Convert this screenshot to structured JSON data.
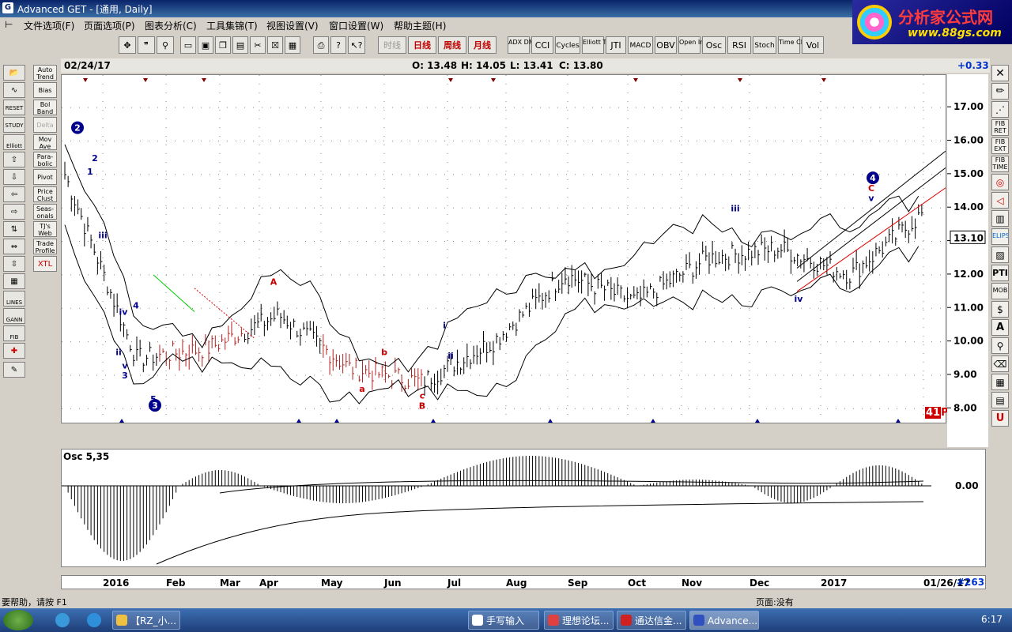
{
  "window": {
    "title": "Advanced GET - [通用, Daily]"
  },
  "logo": {
    "text1": "分析家公式网",
    "text2": "www.88gs.com"
  },
  "menu": [
    "文件选项(F)",
    "页面选项(P)",
    "图表分析(C)",
    "工具集锦(T)",
    "视图设置(V)",
    "窗口设置(W)",
    "帮助主题(H)"
  ],
  "toolbar": {
    "period_buttons": [
      "时线",
      "日线",
      "周线",
      "月线"
    ],
    "study_buttons": [
      "ADX DMI",
      "CCI",
      "Cycles",
      "Elliott Trig",
      "JTI",
      "MACD",
      "OBV",
      "Open Int",
      "Osc",
      "RSI",
      "Stoch",
      "Time Clust",
      "Vol"
    ]
  },
  "left_tools": [
    "RESET",
    "STUDY",
    "Elliott",
    "LINES",
    "GANN",
    "FIB"
  ],
  "study_panel": [
    "Auto Trend",
    "Bias",
    "Bol Band",
    "Delta",
    "Mov Ave",
    "Para-bolic",
    "Pivot",
    "Price Clust",
    "Seas-onals",
    "TJ's Web",
    "Trade Profile",
    "XTL"
  ],
  "right_tools": [
    "FIB RET",
    "FIB EXT",
    "FIB TIME",
    "ELIPS",
    "PTI",
    "MOB"
  ],
  "info": {
    "date": "02/24/17",
    "open": "O: 13.48",
    "high": "H: 14.05",
    "low": "L: 13.41",
    "close": "C: 13.80",
    "change": "+0.33"
  },
  "price_axis": {
    "labels": [
      "17.00",
      "16.00",
      "15.00",
      "14.00",
      "13.00",
      "12.00",
      "11.00",
      "10.00",
      "9.00",
      "8.00"
    ],
    "current": "13.10"
  },
  "osc": {
    "label": "Osc 5,35",
    "zero": "0.00"
  },
  "date_axis": {
    "labels": [
      "2016",
      "Feb",
      "Mar",
      "Apr",
      "May",
      "Jun",
      "Jul",
      "Aug",
      "Sep",
      "Oct",
      "Nov",
      "Dec",
      "2017",
      "01/26/17"
    ],
    "bar_count": "#263"
  },
  "pti": "41",
  "pti_suffix": "PT",
  "waves": {
    "w2": "2",
    "w3": "3",
    "w4": "4",
    "labels": [
      "1",
      "2",
      "iii",
      "iv",
      "ii",
      "v",
      "3",
      "4",
      "5",
      "A",
      "a",
      "b",
      "c",
      "B",
      "i",
      "ii",
      "iii",
      "iv",
      "v",
      "C"
    ]
  },
  "status": {
    "help": "要帮助，请按 F1",
    "page": "页面:没有"
  },
  "taskbar": {
    "items": [
      "【RZ_小...",
      "手写输入",
      "理想论坛...",
      "通达信金...",
      "Advance..."
    ],
    "clock": "6:17"
  },
  "chart_data": {
    "type": "line",
    "title": "",
    "x": [
      "2016",
      "Feb",
      "Mar",
      "Apr",
      "May",
      "Jun",
      "Jul",
      "Aug",
      "Sep",
      "Oct",
      "Nov",
      "Dec",
      "2017"
    ],
    "series": [
      {
        "values": [
          15.0,
          9.5,
          9.8,
          10.8,
          9.2,
          8.8,
          10.0,
          12.0,
          11.2,
          12.5,
          12.8,
          12.0,
          13.8
        ]
      }
    ],
    "ylim": [
      7.7,
      17.5
    ],
    "grid": true
  }
}
